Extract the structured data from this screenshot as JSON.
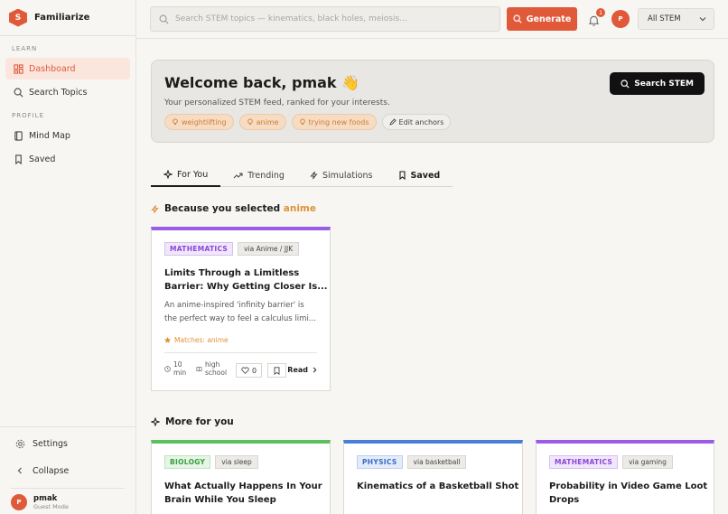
{
  "brand": {
    "logo_letter": "S",
    "name": "Familiarize"
  },
  "sidebar": {
    "learn_label": "LEARN",
    "profile_label": "PROFILE",
    "learn_items": [
      {
        "label": "Dashboard",
        "icon": "dashboard-icon",
        "active": true
      },
      {
        "label": "Search Topics",
        "icon": "search-icon"
      }
    ],
    "profile_items": [
      {
        "label": "Mind Map",
        "icon": "book-icon"
      },
      {
        "label": "Saved",
        "icon": "bookmark-icon"
      }
    ],
    "settings_label": "Settings",
    "collapse_label": "Collapse",
    "user": {
      "initial": "P",
      "name": "pmak",
      "mode": "Guest Mode"
    }
  },
  "topbar": {
    "search_placeholder": "Search STEM topics — kinematics, black holes, meiosis...",
    "generate_label": "Generate",
    "notification_count": "1",
    "avatar_initial": "P",
    "filter_value": "All STEM"
  },
  "welcome": {
    "title": "Welcome back, pmak 👋",
    "subtitle": "Your personalized STEM feed, ranked for your interests.",
    "anchors": [
      "weightlifting",
      "anime",
      "trying new foods"
    ],
    "edit_label": "Edit anchors",
    "search_button": "Search STEM"
  },
  "tabs": [
    {
      "label": "For You",
      "icon": "sparkle-icon",
      "active": true
    },
    {
      "label": "Trending",
      "icon": "trending-icon"
    },
    {
      "label": "Simulations",
      "icon": "bolt-icon"
    },
    {
      "label": "Saved",
      "icon": "bookmark-icon"
    }
  ],
  "because": {
    "prefix": "Because you selected",
    "anchor": "anime"
  },
  "featured_card": {
    "subject": "MATHEMATICS",
    "via": "via Anime / JJK",
    "title_line1": "Limits Through a Limitless",
    "title_line2": "Barrier: Why Getting Closer Is...",
    "desc_line1": "An anime-inspired 'infinity barrier' is",
    "desc_line2": "the perfect way to feel a calculus limi...",
    "match": "Matches: anime",
    "time_line1": "10",
    "time_line2": "min",
    "level_line1": "high",
    "level_line2": "school",
    "likes": "0",
    "read_label": "Read"
  },
  "more_heading": "More for you",
  "more_cards": [
    {
      "subject": "BIOLOGY",
      "via": "via sleep",
      "title_line1": "What Actually Happens In Your",
      "title_line2": "Brain While You Sleep"
    },
    {
      "subject": "PHYSICS",
      "via": "via basketball",
      "title_line1": "Kinematics of a Basketball Shot",
      "title_line2": ""
    },
    {
      "subject": "MATHEMATICS",
      "via": "via gaming",
      "title_line1": "Probability in Video Game Loot",
      "title_line2": "Drops"
    }
  ],
  "colors": {
    "accent": "#e05a3a",
    "anchor": "#e0913a",
    "math": "#9b5de5",
    "bio": "#5cbf60",
    "phys": "#4a7fd8"
  }
}
